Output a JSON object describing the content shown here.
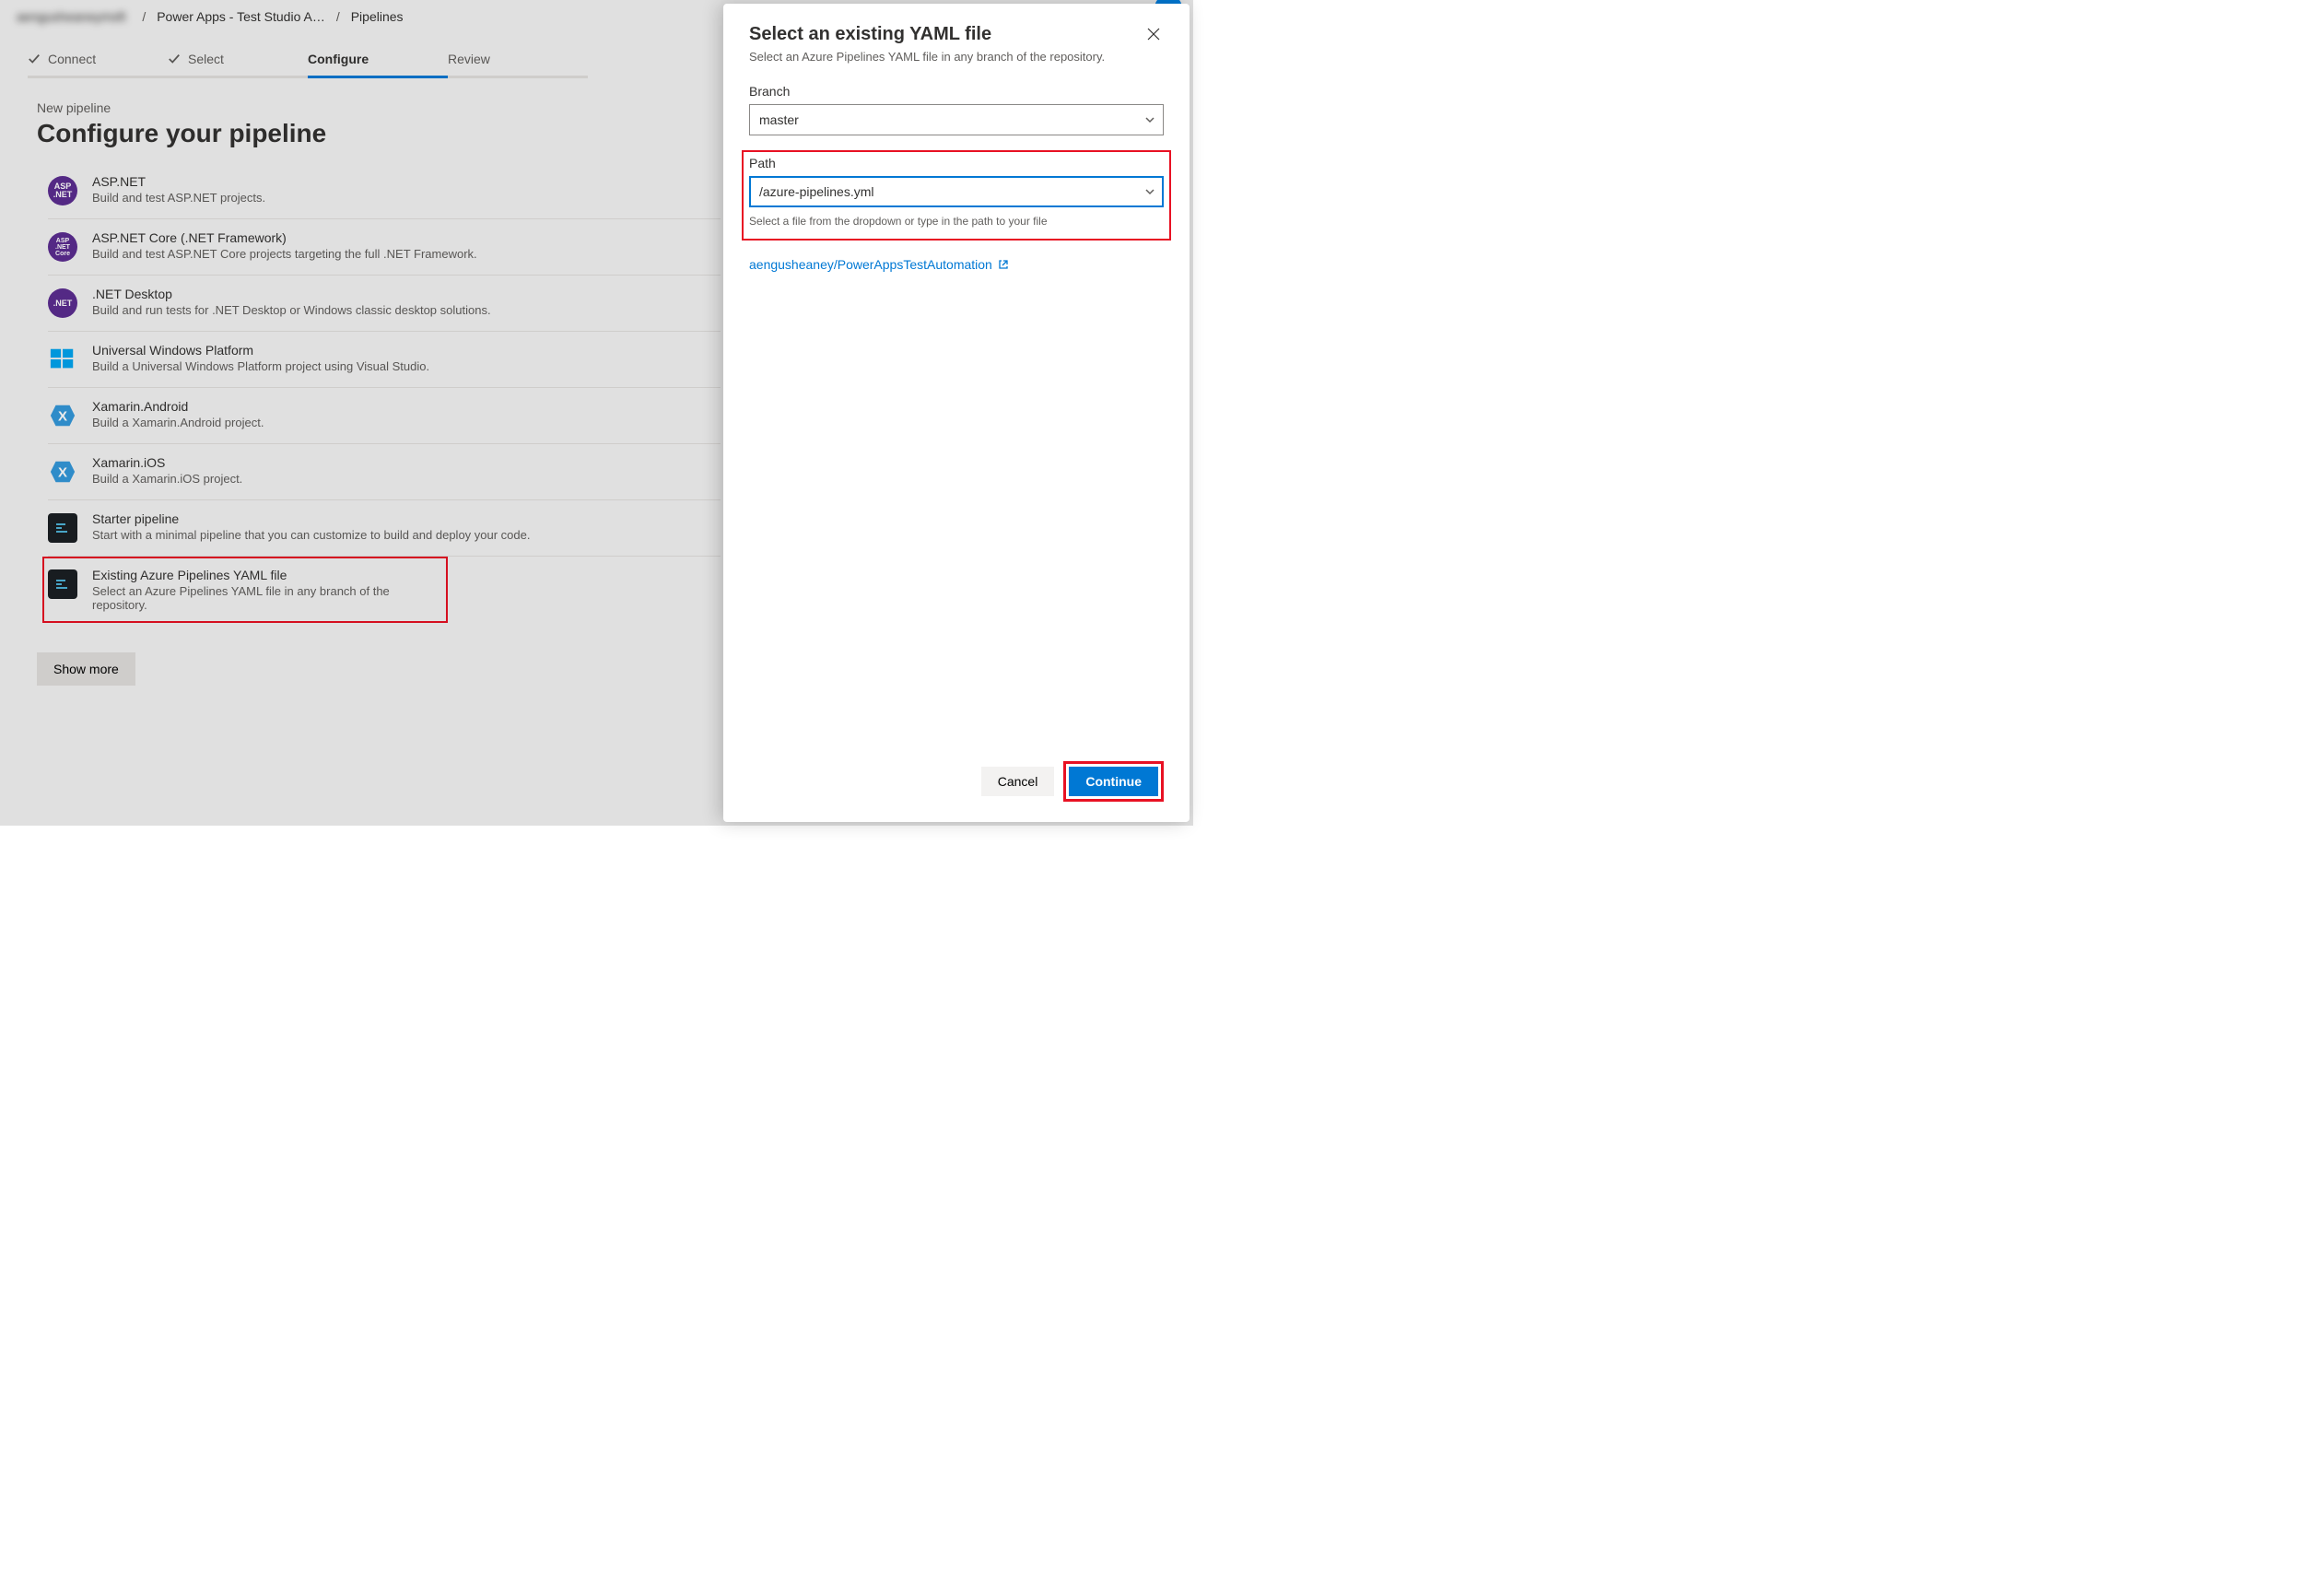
{
  "breadcrumb": {
    "org": "aengusheaneymsft",
    "items": [
      "Power Apps - Test Studio A…",
      "Pipelines"
    ]
  },
  "stepper": {
    "connect": "Connect",
    "select": "Select",
    "configure": "Configure",
    "review": "Review"
  },
  "page": {
    "kicker": "New pipeline",
    "title": "Configure your pipeline",
    "show_more": "Show more"
  },
  "options": [
    {
      "title": "ASP.NET",
      "desc": "Build and test ASP.NET projects.",
      "icon_label": "ASP\n.NET"
    },
    {
      "title": "ASP.NET Core (.NET Framework)",
      "desc": "Build and test ASP.NET Core projects targeting the full .NET Framework.",
      "icon_label": "ASP\n.NET\nCore"
    },
    {
      "title": ".NET Desktop",
      "desc": "Build and run tests for .NET Desktop or Windows classic desktop solutions.",
      "icon_label": ".NET"
    },
    {
      "title": "Universal Windows Platform",
      "desc": "Build a Universal Windows Platform project using Visual Studio."
    },
    {
      "title": "Xamarin.Android",
      "desc": "Build a Xamarin.Android project."
    },
    {
      "title": "Xamarin.iOS",
      "desc": "Build a Xamarin.iOS project."
    },
    {
      "title": "Starter pipeline",
      "desc": "Start with a minimal pipeline that you can customize to build and deploy your code."
    },
    {
      "title": "Existing Azure Pipelines YAML file",
      "desc": "Select an Azure Pipelines YAML file in any branch of the repository."
    }
  ],
  "panel": {
    "title": "Select an existing YAML file",
    "subtitle": "Select an Azure Pipelines YAML file in any branch of the repository.",
    "branch_label": "Branch",
    "branch_value": "master",
    "path_label": "Path",
    "path_value": "/azure-pipelines.yml",
    "path_hint": "Select a file from the dropdown or type in the path to your file",
    "repo_link": "aengusheaney/PowerAppsTestAutomation",
    "cancel": "Cancel",
    "continue": "Continue"
  }
}
